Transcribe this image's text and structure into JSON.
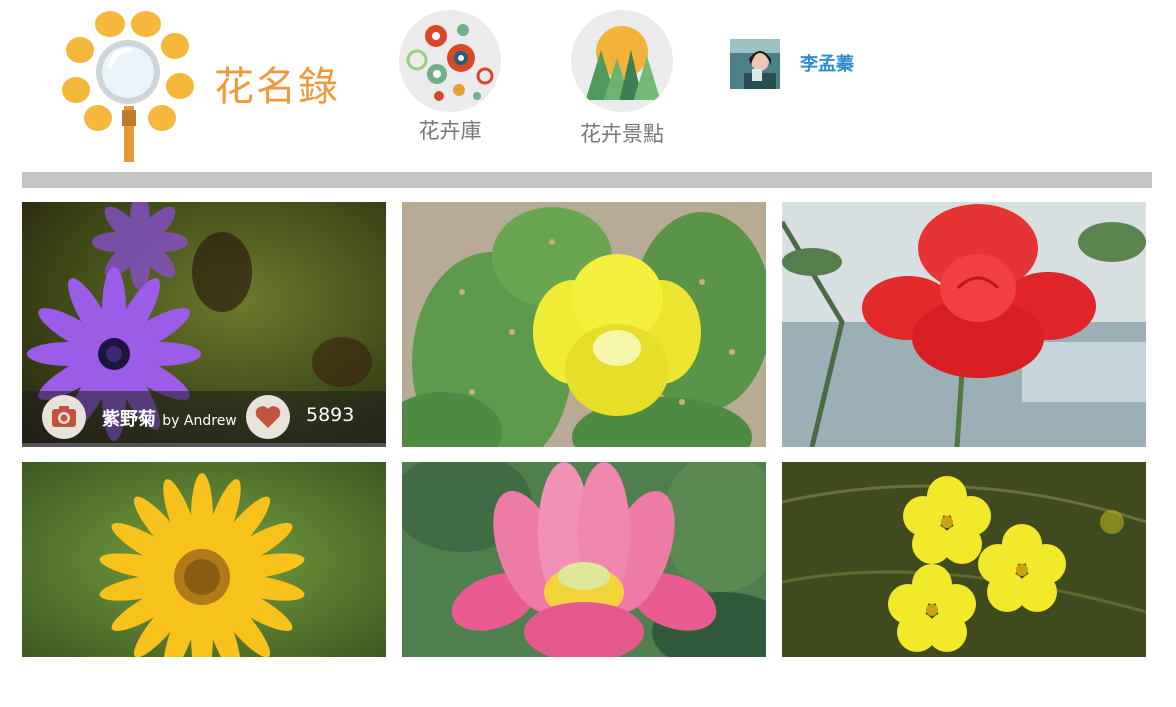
{
  "header": {
    "brand": "花名錄",
    "nav": [
      {
        "label": "花卉庫",
        "icon": "flower-library-icon"
      },
      {
        "label": "花卉景點",
        "icon": "flower-spots-icon"
      }
    ],
    "user": {
      "name": "李孟蓁"
    }
  },
  "photos": [
    {
      "name": "紫野菊",
      "author": "by Andrew",
      "likes": "5893"
    },
    {},
    {},
    {},
    {},
    {}
  ],
  "colors": {
    "brand": "#ee9a3c",
    "user_link": "#2a8fd0",
    "divider": "#c4c4c4"
  }
}
